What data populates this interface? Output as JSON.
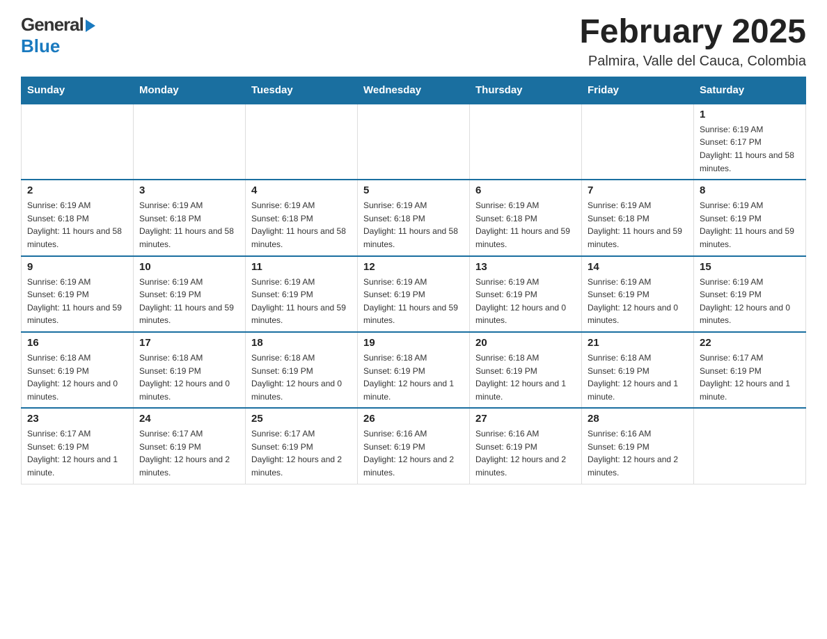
{
  "header": {
    "logo_general": "General",
    "logo_blue": "Blue",
    "title": "February 2025",
    "subtitle": "Palmira, Valle del Cauca, Colombia"
  },
  "days_of_week": [
    "Sunday",
    "Monday",
    "Tuesday",
    "Wednesday",
    "Thursday",
    "Friday",
    "Saturday"
  ],
  "weeks": [
    [
      {
        "day": "",
        "info": ""
      },
      {
        "day": "",
        "info": ""
      },
      {
        "day": "",
        "info": ""
      },
      {
        "day": "",
        "info": ""
      },
      {
        "day": "",
        "info": ""
      },
      {
        "day": "",
        "info": ""
      },
      {
        "day": "1",
        "info": "Sunrise: 6:19 AM\nSunset: 6:17 PM\nDaylight: 11 hours and 58 minutes."
      }
    ],
    [
      {
        "day": "2",
        "info": "Sunrise: 6:19 AM\nSunset: 6:18 PM\nDaylight: 11 hours and 58 minutes."
      },
      {
        "day": "3",
        "info": "Sunrise: 6:19 AM\nSunset: 6:18 PM\nDaylight: 11 hours and 58 minutes."
      },
      {
        "day": "4",
        "info": "Sunrise: 6:19 AM\nSunset: 6:18 PM\nDaylight: 11 hours and 58 minutes."
      },
      {
        "day": "5",
        "info": "Sunrise: 6:19 AM\nSunset: 6:18 PM\nDaylight: 11 hours and 58 minutes."
      },
      {
        "day": "6",
        "info": "Sunrise: 6:19 AM\nSunset: 6:18 PM\nDaylight: 11 hours and 59 minutes."
      },
      {
        "day": "7",
        "info": "Sunrise: 6:19 AM\nSunset: 6:18 PM\nDaylight: 11 hours and 59 minutes."
      },
      {
        "day": "8",
        "info": "Sunrise: 6:19 AM\nSunset: 6:19 PM\nDaylight: 11 hours and 59 minutes."
      }
    ],
    [
      {
        "day": "9",
        "info": "Sunrise: 6:19 AM\nSunset: 6:19 PM\nDaylight: 11 hours and 59 minutes."
      },
      {
        "day": "10",
        "info": "Sunrise: 6:19 AM\nSunset: 6:19 PM\nDaylight: 11 hours and 59 minutes."
      },
      {
        "day": "11",
        "info": "Sunrise: 6:19 AM\nSunset: 6:19 PM\nDaylight: 11 hours and 59 minutes."
      },
      {
        "day": "12",
        "info": "Sunrise: 6:19 AM\nSunset: 6:19 PM\nDaylight: 11 hours and 59 minutes."
      },
      {
        "day": "13",
        "info": "Sunrise: 6:19 AM\nSunset: 6:19 PM\nDaylight: 12 hours and 0 minutes."
      },
      {
        "day": "14",
        "info": "Sunrise: 6:19 AM\nSunset: 6:19 PM\nDaylight: 12 hours and 0 minutes."
      },
      {
        "day": "15",
        "info": "Sunrise: 6:19 AM\nSunset: 6:19 PM\nDaylight: 12 hours and 0 minutes."
      }
    ],
    [
      {
        "day": "16",
        "info": "Sunrise: 6:18 AM\nSunset: 6:19 PM\nDaylight: 12 hours and 0 minutes."
      },
      {
        "day": "17",
        "info": "Sunrise: 6:18 AM\nSunset: 6:19 PM\nDaylight: 12 hours and 0 minutes."
      },
      {
        "day": "18",
        "info": "Sunrise: 6:18 AM\nSunset: 6:19 PM\nDaylight: 12 hours and 0 minutes."
      },
      {
        "day": "19",
        "info": "Sunrise: 6:18 AM\nSunset: 6:19 PM\nDaylight: 12 hours and 1 minute."
      },
      {
        "day": "20",
        "info": "Sunrise: 6:18 AM\nSunset: 6:19 PM\nDaylight: 12 hours and 1 minute."
      },
      {
        "day": "21",
        "info": "Sunrise: 6:18 AM\nSunset: 6:19 PM\nDaylight: 12 hours and 1 minute."
      },
      {
        "day": "22",
        "info": "Sunrise: 6:17 AM\nSunset: 6:19 PM\nDaylight: 12 hours and 1 minute."
      }
    ],
    [
      {
        "day": "23",
        "info": "Sunrise: 6:17 AM\nSunset: 6:19 PM\nDaylight: 12 hours and 1 minute."
      },
      {
        "day": "24",
        "info": "Sunrise: 6:17 AM\nSunset: 6:19 PM\nDaylight: 12 hours and 2 minutes."
      },
      {
        "day": "25",
        "info": "Sunrise: 6:17 AM\nSunset: 6:19 PM\nDaylight: 12 hours and 2 minutes."
      },
      {
        "day": "26",
        "info": "Sunrise: 6:16 AM\nSunset: 6:19 PM\nDaylight: 12 hours and 2 minutes."
      },
      {
        "day": "27",
        "info": "Sunrise: 6:16 AM\nSunset: 6:19 PM\nDaylight: 12 hours and 2 minutes."
      },
      {
        "day": "28",
        "info": "Sunrise: 6:16 AM\nSunset: 6:19 PM\nDaylight: 12 hours and 2 minutes."
      },
      {
        "day": "",
        "info": ""
      }
    ]
  ]
}
